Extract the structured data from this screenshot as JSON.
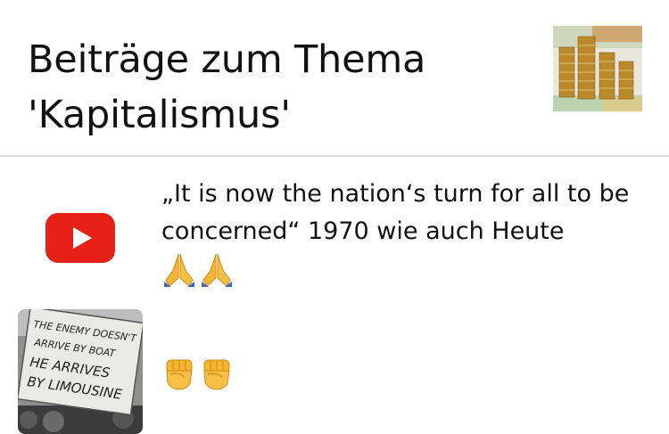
{
  "page": {
    "title": "Beiträge zum Thema 'Kapitalismus'"
  },
  "posts": [
    {
      "text": "„It is now the nation‘s turn for all to be concerned“ 1970 wie auch Heute",
      "emoji": "🙏🙏",
      "thumbnail_icon": "youtube-icon"
    },
    {
      "text": "",
      "emoji": "✊✊",
      "sign_lines": [
        "THE ENEMY DOESN'T",
        "ARRIVE BY BOAT",
        "HE ARRIVES",
        "BY LIMOUSINE"
      ],
      "thumbnail_icon": "protest-sign-photo"
    }
  ],
  "colors": {
    "youtube_red": "#e62117",
    "divider": "#d7d7d7"
  }
}
